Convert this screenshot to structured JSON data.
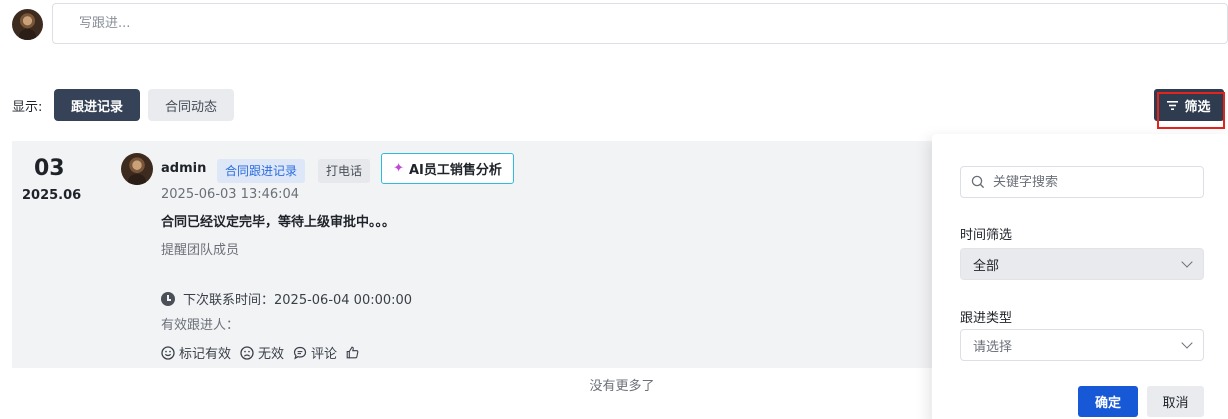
{
  "composer": {
    "placeholder": "写跟进..."
  },
  "display": {
    "label": "显示:",
    "tabs": [
      {
        "label": "跟进记录"
      },
      {
        "label": "合同动态"
      }
    ]
  },
  "filter_button": {
    "label": "筛选",
    "icon": "filter-icon"
  },
  "record": {
    "day": "03",
    "month": "2025.06",
    "user": "admin",
    "tag_type": "合同跟进记录",
    "tag_method": "打电话",
    "ai_button": "AI员工销售分析",
    "time": "2025-06-03 13:46:04",
    "content": "合同已经议定完毕，等待上级审批中。。。",
    "remind": "提醒团队成员",
    "next_contact": "下次联系时间：2025-06-04 00:00:00",
    "valid_followers": "有效跟进人：",
    "actions": {
      "mark_valid": "标记有效",
      "invalid": "无效",
      "comment": "评论"
    }
  },
  "list_footer": "没有更多了",
  "filter_panel": {
    "search_placeholder": "关键字搜索",
    "time_label": "时间筛选",
    "time_value": "全部",
    "type_label": "跟进类型",
    "type_placeholder": "请选择",
    "confirm": "确定",
    "cancel": "取消"
  },
  "colors": {
    "primary": "#1758d6",
    "dark_button": "#354258",
    "highlight_box": "#e3241c",
    "ai_border": "#2dbbe0"
  }
}
